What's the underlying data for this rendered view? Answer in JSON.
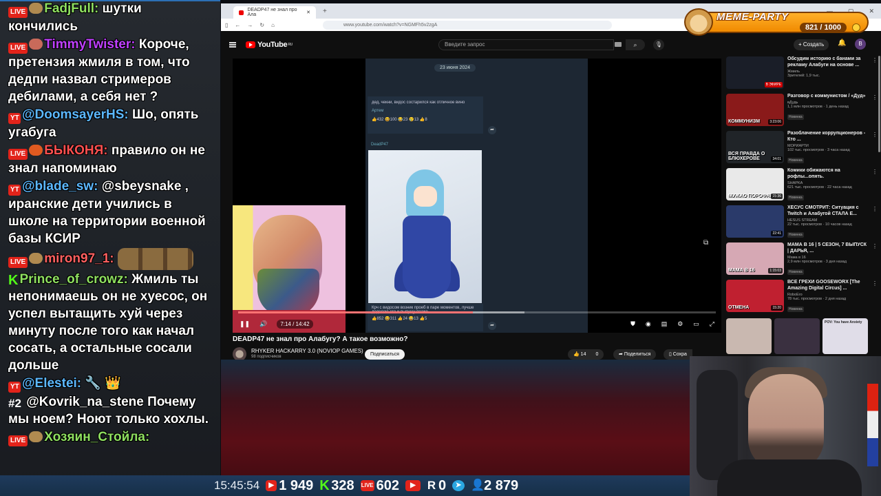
{
  "chat": {
    "messages": [
      {
        "badge": "LIVE",
        "user": "FadjFull:",
        "user_color": "#8fe060",
        "text": "шутки кончились"
      },
      {
        "badge": "LIVE",
        "user": "TimmyTwister:",
        "user_color": "#c040ff",
        "text": "Короче, претензия жмиля в том, что дедпи назвал стримеров дебилами, а себя нет ?"
      },
      {
        "badge": "YT",
        "user": "@DoomsayerHS:",
        "user_color": "#5cb8ff",
        "text": "Шо, опять угабуга"
      },
      {
        "badge": "LIVE",
        "user": "БЫКОНЯ:",
        "user_color": "#ff5050",
        "text": "правило он не знал напоминаю"
      },
      {
        "badge": "YT",
        "user": "@blade_sw:",
        "user_color": "#5cb8ff",
        "text": "@sbeysnake , иранские дети учились в школе на территории военной базы КСИР"
      },
      {
        "badge": "LIVE",
        "user": "miron97_1:",
        "user_color": "#ff6060",
        "text": ""
      },
      {
        "badge": "K",
        "user": "Prince_of_crowz:",
        "user_color": "#8fe060",
        "text": "Жмиль ты непонимаешь он не хуесос, он успел вытащить хуй через минуту после того как начал сосать, а остальные сосали дольше"
      },
      {
        "badge": "YT",
        "user": "@Elestei:",
        "user_color": "#5cb8ff",
        "text": "🔧 👑"
      },
      {
        "badge": "#2",
        "user": "",
        "user_color": "#fff",
        "text": "@Kovrik_na_stene Почему мы ноем? Ноют только хохлы."
      },
      {
        "badge": "LIVE",
        "user": "Хозяин_Стойла:",
        "user_color": "#8fe060",
        "text": ""
      }
    ]
  },
  "browser": {
    "tab_title": "DEADP47 не знал про Ала",
    "url": "www.youtube.com/watch?v=NGMFh5v2zgA",
    "yt_logo": "YouTube",
    "yt_logo_sup": "RU",
    "search_placeholder": "Введите запрос",
    "create_label": "Создать",
    "avatar_letter": "В"
  },
  "player": {
    "phone_date": "23 июня 2024",
    "msg1_text": "дед, чекни, видос состарился как отличное вино",
    "msg1_author": "Артем",
    "msg1_reacts": "👍432  😆100  😂23  😢13  👍8",
    "sender": "DeadP47",
    "msg2_text": "Крч с видосом возник проеб в паре моментов, лучше доделаю его и выпущу позже",
    "msg2_reacts": "👍852  😆311  👍24  😂13  👍5",
    "timecode": "7:14 / 14:42",
    "progress": 0.492,
    "buffered": 0.6
  },
  "video": {
    "title": "DEADP47 не знал про Алабугу? А такое возможно?",
    "channel": "RHYKER HACKARRY 3.0 (NOVIOP GAMES)",
    "subscribers": "98 подписчиков",
    "subscribe_label": "Подписаться",
    "likes": "14",
    "dislikes": "0",
    "share_label": "Поделиться",
    "save_label": "Сохра"
  },
  "recommendations": [
    {
      "title": "Обсудим историю с банами за рекламу Алабуги на основе ...",
      "channel": "Жмиль",
      "meta": "Зрителей: 1,9 тыс.",
      "badge": "В ЭФИРЕ",
      "thumb_color": "#1a1e28",
      "caption": ""
    },
    {
      "title": "Разговор с коммунистом / «Дуд»",
      "channel": "вДудь",
      "meta": "1,1 млн просмотров · 1 день назад",
      "duration": "3:23:06",
      "new": "Новинка",
      "thumb_color": "#8a1a1a",
      "caption": "КОММУНИЗМ"
    },
    {
      "title": "Разоблачение коррупционеров - Кто ...",
      "channel": "МОРИАРТИ",
      "meta": "102 тыс. просмотров · 3 часа назад",
      "duration": "34:01",
      "new": "Новинка",
      "thumb_color": "#202428",
      "caption": "ВСЯ ПРАВДА О БЛЮХЕРОВЕ"
    },
    {
      "title": "Комики обижаются на рофлы...опять.",
      "channel": "SHAPKA",
      "meta": "621 тыс. просмотров · 22 часа назад",
      "duration": "15:36",
      "new": "Новинка",
      "thumb_color": "#e9e9e9",
      "caption": "МУЖАО ПОРОФАИЛ"
    },
    {
      "title": "ХЕСУС СМОТРИТ: Ситуация с Twitch и Алабугой СТАЛА Е...",
      "channel": "HESUS STREAM",
      "meta": "22 тыс. просмотров · 10 часов назад",
      "duration": "22:41",
      "new": "Новинка",
      "thumb_color": "#2a3a6a",
      "caption": ""
    },
    {
      "title": "МАМА В 16 | 5 СЕЗОН, 7 ВЫПУСК | ДАРЬЯ, ...",
      "channel": "Мама в 16",
      "meta": "2,9 млн просмотров · 3 дня назад",
      "duration": "1:15:03",
      "new": "Новинка",
      "thumb_color": "#d6a8b4",
      "caption": "МАМА В 16"
    },
    {
      "title": "ВСЕ ГРЕХИ GOOSEWORX [The Amazing Digital Circus] ...",
      "channel": "RoboEro",
      "meta": "78 тыс. просмотров · 2 дня назад",
      "duration": "15:20",
      "new": "Новинка",
      "thumb_color": "#c02030",
      "caption": "ОТМЕНА"
    }
  ],
  "shorts": [
    {
      "color": "#c9b8b0",
      "label": ""
    },
    {
      "color": "#3a3040",
      "label": ""
    },
    {
      "color": "#e0dde8",
      "label": "POV: You have Anxiety"
    }
  ],
  "meme_party": {
    "title": "MEME-PARTY",
    "counter": "821 / 1000"
  },
  "stats": {
    "clock": "15:45:54",
    "youtube": "1 949",
    "kick": "328",
    "live": "602",
    "rutube": "0",
    "telegram": "",
    "viewers": "2 879"
  }
}
